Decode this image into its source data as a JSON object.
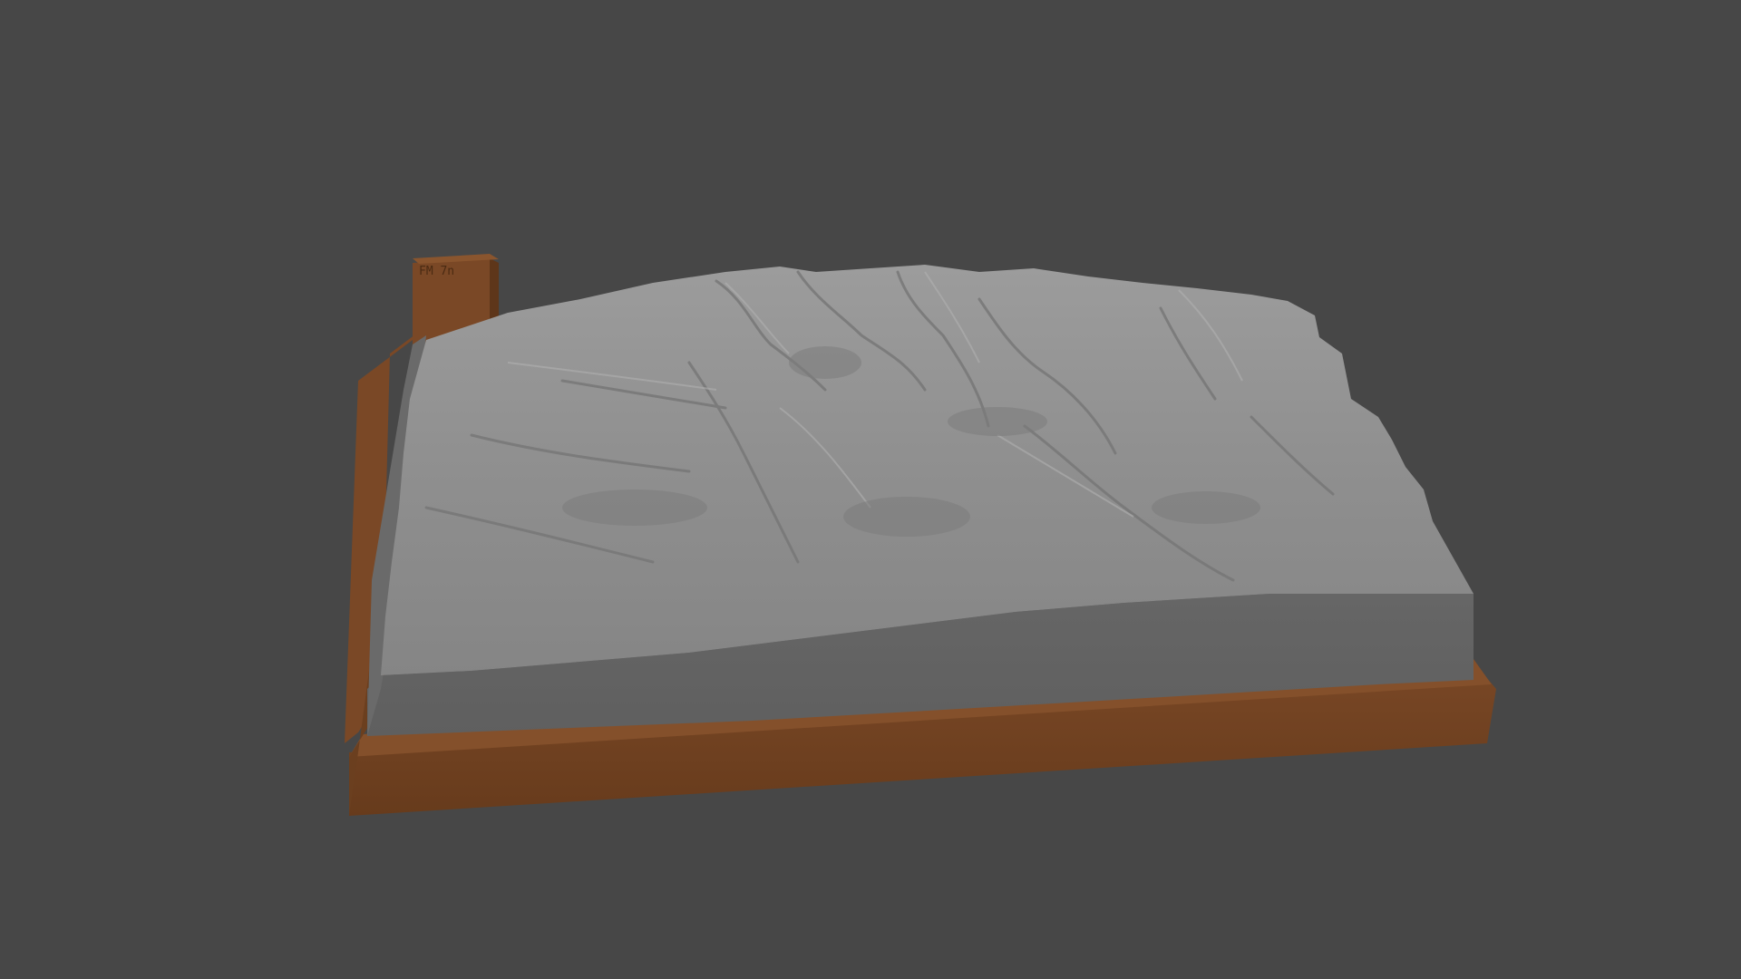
{
  "viewport": {
    "background_color": "#474747"
  },
  "model": {
    "terrain_color": "#8e8e8e",
    "terrain_shadow_color": "#6f6f6f",
    "terrain_side_color": "#636363",
    "base_color": "#6b3f1f",
    "base_light_color": "#7a4826"
  },
  "label_block": {
    "engraving": "FM 7n"
  }
}
